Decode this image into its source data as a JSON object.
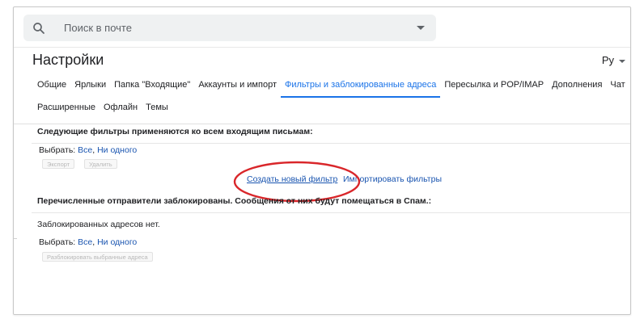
{
  "search": {
    "placeholder": "Поиск в почте",
    "icon": "search-icon"
  },
  "header": {
    "title": "Настройки",
    "language": "Ру"
  },
  "tabs_row1": [
    {
      "label": "Общие",
      "active": false
    },
    {
      "label": "Ярлыки",
      "active": false
    },
    {
      "label": "Папка \"Входящие\"",
      "active": false
    },
    {
      "label": "Аккаунты и импорт",
      "active": false
    },
    {
      "label": "Фильтры и заблокированные адреса",
      "active": true
    },
    {
      "label": "Пересылка и POP/IMAP",
      "active": false
    },
    {
      "label": "Дополнения",
      "active": false
    },
    {
      "label": "Чат",
      "active": false
    }
  ],
  "tabs_row2": [
    {
      "label": "Расширенные",
      "active": false
    },
    {
      "label": "Офлайн",
      "active": false
    },
    {
      "label": "Темы",
      "active": false
    }
  ],
  "filters": {
    "heading": "Следующие фильтры применяются ко всем входящим письмам:",
    "select_label": "Выбрать:",
    "select_all": "Все",
    "separator": ",",
    "select_none": "Ни одного",
    "export_button": "Экспорт",
    "delete_button": "Удалить",
    "create_filter": "Создать новый фильтр",
    "import_filters": "Импортировать фильтры"
  },
  "blocked": {
    "heading": "Перечисленные отправители заблокированы. Сообщения от них будут помещаться в Спам.:",
    "empty_text": "Заблокированных адресов нет.",
    "select_label": "Выбрать:",
    "select_all": "Все",
    "separator": ",",
    "select_none": "Ни одного",
    "unblock_button": "Разблокировать выбранные адреса"
  },
  "colors": {
    "accent": "#1a73e8",
    "link": "#1a55b0",
    "highlight": "#d9262a"
  }
}
